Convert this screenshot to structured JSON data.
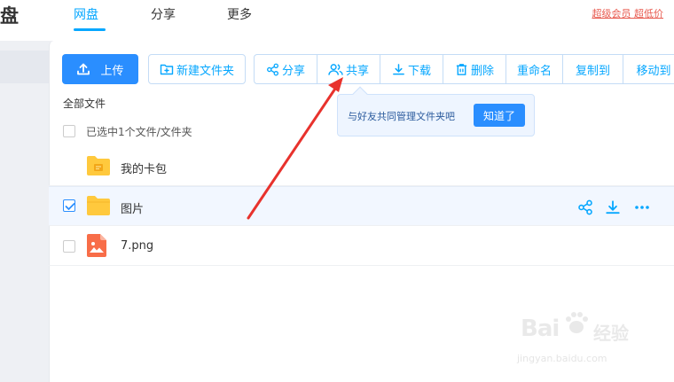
{
  "header": {
    "logo_char": "盘",
    "tabs": [
      {
        "label": "网盘",
        "active": true
      },
      {
        "label": "分享",
        "active": false
      },
      {
        "label": "更多",
        "active": false
      }
    ],
    "promo_link": "超级会员 超低价"
  },
  "toolbar": {
    "upload_label": "上传",
    "new_folder_label": "新建文件夹",
    "actions": [
      {
        "label": "分享",
        "icon": "share-icon"
      },
      {
        "label": "共享",
        "icon": "people-icon"
      },
      {
        "label": "下载",
        "icon": "download-icon"
      },
      {
        "label": "删除",
        "icon": "trash-icon"
      },
      {
        "label": "重命名",
        "icon": ""
      },
      {
        "label": "复制到",
        "icon": ""
      },
      {
        "label": "移动到",
        "icon": ""
      }
    ]
  },
  "breadcrumb": "全部文件",
  "selection_text": "已选中1个文件/文件夹",
  "files": [
    {
      "name": "我的卡包",
      "type": "card-folder",
      "checked": false
    },
    {
      "name": "图片",
      "type": "folder",
      "checked": true
    },
    {
      "name": "7.png",
      "type": "image",
      "checked": false
    }
  ],
  "tooltip": {
    "text": "与好友共同管理文件夹吧",
    "button": "知道了"
  },
  "watermark": {
    "brand": "Bai",
    "brand2": "经验",
    "url": "jingyan.baidu.com"
  },
  "colors": {
    "accent": "#06a7ff",
    "primary_button": "#2a8eff",
    "annotation_arrow": "#e8322d",
    "folder": "#ffc93d",
    "image_file": "#f86d48"
  }
}
